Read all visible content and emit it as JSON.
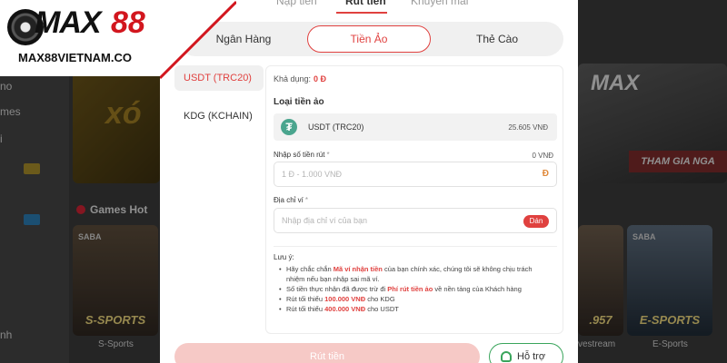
{
  "brand": {
    "logo_max": "MAX",
    "logo_num": "88",
    "site": "MAX88VIETNAM.CO"
  },
  "background": {
    "sidebar_items": [
      "no",
      "mes",
      "i",
      "nh"
    ],
    "banner_left_text": "xó",
    "banner_right_logo": "MAX",
    "banner_right_cta": "THAM GIA NGA",
    "games_title": "Games Hot",
    "card_badges": [
      "SABA",
      "SABA"
    ],
    "card_titles": [
      "S-SPORTS",
      ".957",
      "E-SPORTS"
    ],
    "card_labels": [
      "S-Sports",
      "vestream",
      "E-Sports"
    ]
  },
  "top_tabs": [
    {
      "label": "Nạp tiền",
      "active": false
    },
    {
      "label": "Rút tiền",
      "active": true
    },
    {
      "label": "Khuyến mãi",
      "active": false
    }
  ],
  "method_tabs": [
    {
      "label": "Ngân Hàng",
      "active": false
    },
    {
      "label": "Tiền Ảo",
      "active": true
    },
    {
      "label": "Thẻ Cào",
      "active": false
    }
  ],
  "crypto_list": [
    {
      "label": "USDT (TRC20)",
      "active": true
    },
    {
      "label": "KDG (KCHAIN)",
      "active": false
    }
  ],
  "form": {
    "available_label": "Khả dụng:",
    "available_value": "0 Đ",
    "coin_type_label": "Loại tiền ảo",
    "coin_name": "USDT (TRC20)",
    "coin_rate": "25.605 VNĐ",
    "amount_label": "Nhập số tiền rút",
    "amount_required": "*",
    "amount_converted": "0 VNĐ",
    "amount_placeholder": "1 Đ - 1.000 VNĐ",
    "currency_icon": "Đ",
    "address_label": "Địa chỉ ví",
    "address_required": "*",
    "address_placeholder": "Nhập địa chỉ ví của bạn",
    "paste_label": "Dán"
  },
  "notes": {
    "title": "Lưu ý:",
    "items": [
      {
        "before": "Hãy chắc chắn ",
        "highlight": "Mã ví nhận tiền",
        "after": " của bạn chính xác, chúng tôi sẽ không chịu trách nhiệm nếu bạn nhập sai mã ví."
      },
      {
        "before": "Số tiền thực nhận đã được trừ đi ",
        "highlight": "Phí rút tiền ảo",
        "after": " về nền tảng của Khách hàng"
      },
      {
        "before": "Rút tối thiểu ",
        "highlight": "100.000 VNĐ",
        "after": " cho KDG"
      },
      {
        "before": "Rút tối thiểu ",
        "highlight": "400.000 VNĐ",
        "after": " cho USDT"
      }
    ]
  },
  "actions": {
    "submit_label": "Rút tiền",
    "support_label": "Hỗ trợ"
  },
  "colors": {
    "accent": "#e0413f",
    "support": "#3aa55c",
    "tether": "#4aa58e"
  }
}
